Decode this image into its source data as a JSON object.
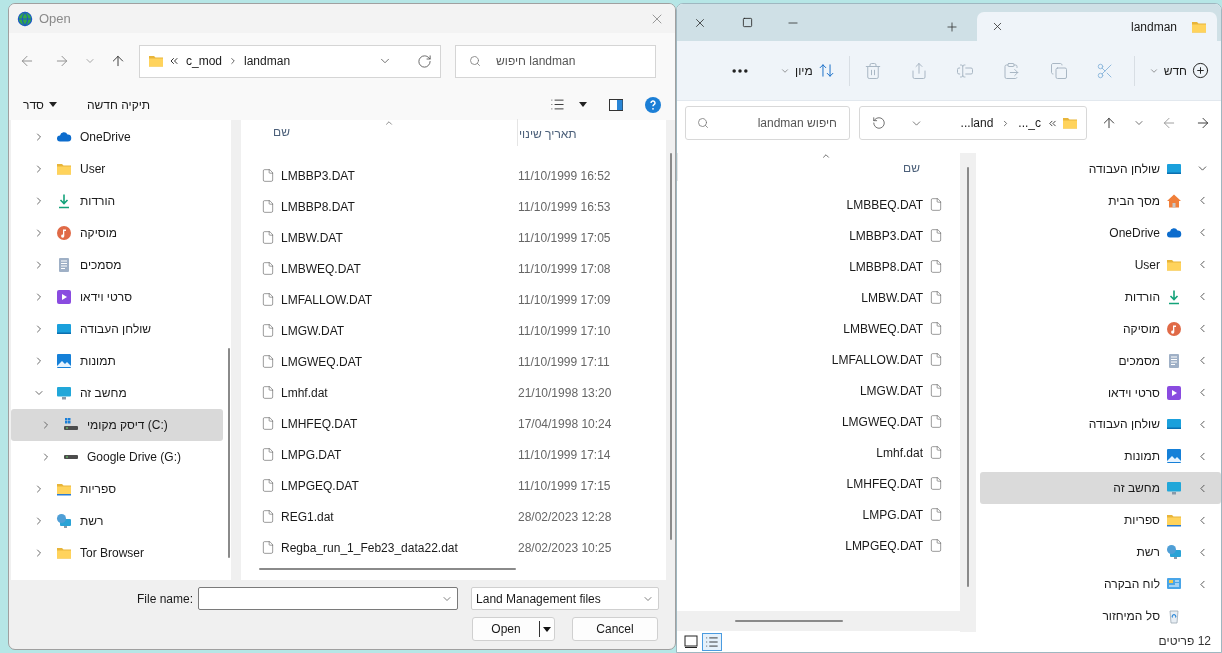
{
  "dialog": {
    "title": "Open",
    "address": {
      "parent": "c_mod",
      "folder": "landman"
    },
    "search_placeholder": "חיפוש landman",
    "commands": {
      "organize": "סדר",
      "new_folder": "תיקיה חדשה"
    },
    "sidebar": [
      {
        "label": "OneDrive",
        "kind": "cloud",
        "expanded": false,
        "selected": false
      },
      {
        "label": "User",
        "kind": "folder",
        "expanded": false,
        "selected": false
      },
      {
        "label": "הורדות",
        "kind": "download",
        "expanded": false,
        "selected": false
      },
      {
        "label": "מוסיקה",
        "kind": "music",
        "expanded": false,
        "selected": false
      },
      {
        "label": "מסמכים",
        "kind": "document",
        "expanded": false,
        "selected": false
      },
      {
        "label": "סרטי וידאו",
        "kind": "video",
        "expanded": false,
        "selected": false
      },
      {
        "label": "שולחן העבודה",
        "kind": "desktop",
        "expanded": false,
        "selected": false
      },
      {
        "label": "תמונות",
        "kind": "picture",
        "expanded": false,
        "selected": false
      },
      {
        "label": "מחשב זה",
        "kind": "monitor",
        "expanded": true,
        "selected": false,
        "children": [
          {
            "label": "דיסק מקומי (C:)",
            "kind": "system-drive",
            "expanded": false,
            "selected": true
          },
          {
            "label": "Google Drive (G:)",
            "kind": "drive",
            "expanded": false,
            "selected": false
          }
        ]
      },
      {
        "label": "ספריות",
        "kind": "library",
        "expanded": false,
        "selected": false
      },
      {
        "label": "רשת",
        "kind": "network",
        "expanded": false,
        "selected": false
      },
      {
        "label": "Tor Browser",
        "kind": "folder",
        "expanded": false,
        "selected": false
      }
    ],
    "name_column": "שם",
    "date_column": "תאריך שינוי",
    "files": [
      {
        "name": "LMBBP3.DAT",
        "date": "11/10/1999 16:52"
      },
      {
        "name": "LMBBP8.DAT",
        "date": "11/10/1999 16:53"
      },
      {
        "name": "LMBW.DAT",
        "date": "11/10/1999 17:05"
      },
      {
        "name": "LMBWEQ.DAT",
        "date": "11/10/1999 17:08"
      },
      {
        "name": "LMFALLOW.DAT",
        "date": "11/10/1999 17:09"
      },
      {
        "name": "LMGW.DAT",
        "date": "11/10/1999 17:10"
      },
      {
        "name": "LMGWEQ.DAT",
        "date": "11/10/1999 17:11"
      },
      {
        "name": "Lmhf.dat",
        "date": "21/10/1998 13:20"
      },
      {
        "name": "LMHFEQ.DAT",
        "date": "17/04/1998 10:24"
      },
      {
        "name": "LMPG.DAT",
        "date": "11/10/1999 17:14"
      },
      {
        "name": "LMPGEQ.DAT",
        "date": "11/10/1999 17:15"
      },
      {
        "name": "REG1.dat",
        "date": "28/02/2023 12:28"
      },
      {
        "name": "Regba_run_1_Feb23_data22.dat",
        "date": "28/02/2023 10:25"
      }
    ],
    "file_name_label": "File name:",
    "filter": "Land Management files",
    "buttons": {
      "open": "Open",
      "cancel": "Cancel"
    }
  },
  "explorer": {
    "tab": "landman",
    "toolbar": {
      "new": "חדש",
      "sort": "מיון"
    },
    "address": {
      "parent": "c_...",
      "folder": "land..."
    },
    "search_placeholder": "חיפוש landman",
    "column": "שם",
    "files": [
      "LMBBEQ.DAT",
      "LMBBP3.DAT",
      "LMBBP8.DAT",
      "LMBW.DAT",
      "LMBWEQ.DAT",
      "LMFALLOW.DAT",
      "LMGW.DAT",
      "LMGWEQ.DAT",
      "Lmhf.dat",
      "LMHFEQ.DAT",
      "LMPG.DAT",
      "LMPGEQ.DAT"
    ],
    "sidebar": [
      {
        "label": "שולחן העבודה",
        "kind": "desktop",
        "expanded": true,
        "selected": false
      },
      {
        "label": "מסך הבית",
        "kind": "home",
        "expanded": false,
        "selected": false
      },
      {
        "label": "OneDrive",
        "kind": "cloud",
        "expanded": false,
        "selected": false
      },
      {
        "label": "User",
        "kind": "folder",
        "expanded": false,
        "selected": false
      },
      {
        "label": "הורדות",
        "kind": "download",
        "expanded": false,
        "selected": false
      },
      {
        "label": "מוסיקה",
        "kind": "music",
        "expanded": false,
        "selected": false
      },
      {
        "label": "מסמכים",
        "kind": "document",
        "expanded": false,
        "selected": false
      },
      {
        "label": "סרטי וידאו",
        "kind": "video",
        "expanded": false,
        "selected": false
      },
      {
        "label": "שולחן העבודה",
        "kind": "desktop",
        "expanded": false,
        "selected": false
      },
      {
        "label": "תמונות",
        "kind": "picture",
        "expanded": false,
        "selected": false
      },
      {
        "label": "מחשב זה",
        "kind": "monitor",
        "expanded": false,
        "selected": true
      },
      {
        "label": "ספריות",
        "kind": "library",
        "expanded": false,
        "selected": false
      },
      {
        "label": "רשת",
        "kind": "network",
        "expanded": false,
        "selected": false
      },
      {
        "label": "לוח הבקרה",
        "kind": "control-panel",
        "expanded": false,
        "selected": false
      },
      {
        "label": "סל המיחזור",
        "kind": "recycle-bin",
        "selected": false
      }
    ],
    "status": "12 פריטים"
  }
}
